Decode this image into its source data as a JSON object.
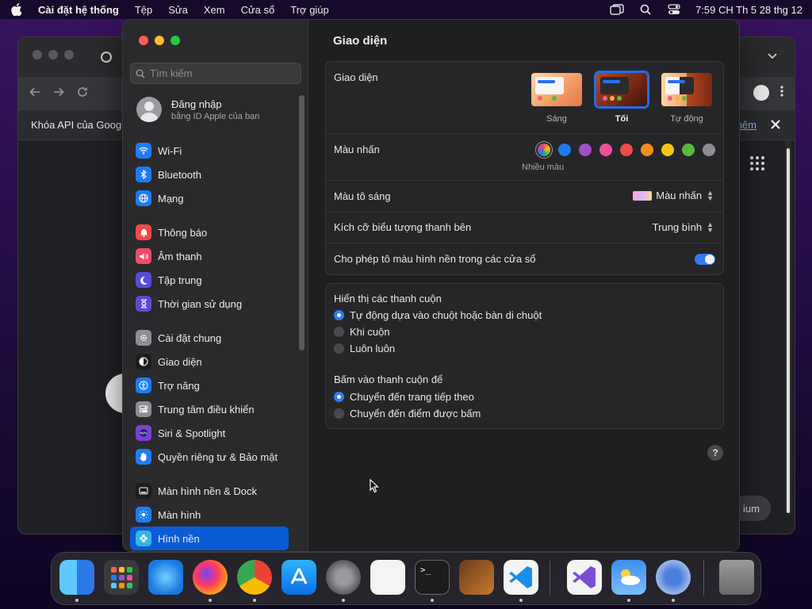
{
  "menubar": {
    "app_name": "Cài đặt hệ thống",
    "items": [
      "Tệp",
      "Sửa",
      "Xem",
      "Cửa sổ",
      "Trợ giúp"
    ],
    "clock": "7:59 CH Th 5 28 thg 12"
  },
  "browser": {
    "infobar_text": "Khóa API của Goog",
    "infobar_link": "hêm",
    "pill_text": "ium"
  },
  "sidebar": {
    "search_placeholder": "Tìm kiếm",
    "account": {
      "title": "Đăng nhập",
      "subtitle": "bằng ID Apple của bạn"
    },
    "groups": [
      [
        {
          "label": "Wi-Fi",
          "icon": "wifi-icon",
          "color": "#1e7cf2"
        },
        {
          "label": "Bluetooth",
          "icon": "bluetooth-icon",
          "color": "#1e7cf2"
        },
        {
          "label": "Mạng",
          "icon": "globe-icon",
          "color": "#1e7cf2"
        }
      ],
      [
        {
          "label": "Thông báo",
          "icon": "bell-icon",
          "color": "#ef4b43"
        },
        {
          "label": "Âm thanh",
          "icon": "speaker-icon",
          "color": "#ef4b6b"
        },
        {
          "label": "Tập trung",
          "icon": "moon-icon",
          "color": "#5a4bd6"
        },
        {
          "label": "Thời gian sử dụng",
          "icon": "hourglass-icon",
          "color": "#5a4bd6"
        }
      ],
      [
        {
          "label": "Cài đặt chung",
          "icon": "gear-icon",
          "color": "#8e8e93"
        },
        {
          "label": "Giao diện",
          "icon": "appearance-icon",
          "color": "#1c1c1e"
        },
        {
          "label": "Trợ năng",
          "icon": "accessibility-icon",
          "color": "#1e7cf2"
        },
        {
          "label": "Trung tâm điều khiển",
          "icon": "control-center-icon",
          "color": "#8e8e93"
        },
        {
          "label": "Siri & Spotlight",
          "icon": "siri-icon",
          "color": "#7a3fd8"
        },
        {
          "label": "Quyền riêng tư & Bảo mật",
          "icon": "hand-icon",
          "color": "#1e7cf2"
        }
      ],
      [
        {
          "label": "Màn hình nền & Dock",
          "icon": "dock-icon",
          "color": "#1c1c1e"
        },
        {
          "label": "Màn hình",
          "icon": "sun-icon",
          "color": "#1e7cf2"
        },
        {
          "label": "Hình nền",
          "icon": "wallpaper-icon",
          "color": "#35b5e8",
          "active": true
        }
      ]
    ]
  },
  "main": {
    "title": "Giao diện",
    "appearance": {
      "label": "Giao diện",
      "options": [
        {
          "caption": "Sáng",
          "selected": false
        },
        {
          "caption": "Tối",
          "selected": true
        },
        {
          "caption": "Tự động",
          "selected": false
        }
      ]
    },
    "accent": {
      "label": "Màu nhấn",
      "caption": "Nhiều màu",
      "colors": [
        "multicolor",
        "#1e7cf2",
        "#a050c8",
        "#f0509a",
        "#f04a4a",
        "#f58c1e",
        "#f5c518",
        "#5ab840",
        "#8e8e93"
      ],
      "selected_index": 0
    },
    "highlight": {
      "label": "Màu tô sáng",
      "value": "Màu nhấn"
    },
    "sidebar_icon_size": {
      "label": "Kích cỡ biểu tượng thanh bên",
      "value": "Trung bình"
    },
    "wallpaper_tint": {
      "label": "Cho phép tô màu hình nền trong các cửa sổ",
      "on": true
    },
    "scrollbars": {
      "heading": "Hiển thị các thanh cuộn",
      "options": [
        "Tự động dựa vào chuột hoặc bàn di chuột",
        "Khi cuộn",
        "Luôn luôn"
      ],
      "selected_index": 0
    },
    "click_scrollbar": {
      "heading": "Bấm vào thanh cuộn để",
      "options": [
        "Chuyển đến trang tiếp theo",
        "Chuyển đến điểm được bấm"
      ],
      "selected_index": 0
    },
    "help": "?"
  },
  "dock": {
    "apps": [
      "finder-icon",
      "launchpad-icon",
      "safari-icon",
      "firefox-icon",
      "chrome-icon",
      "app-store-icon",
      "system-settings-icon",
      "textedit-icon",
      "terminal-icon",
      "garageband-icon",
      "vscode-icon",
      "visual-studio-icon",
      "weather-icon",
      "chromium-icon",
      "trash-icon"
    ],
    "running": [
      "finder-icon",
      "firefox-icon",
      "chrome-icon",
      "system-settings-icon",
      "terminal-icon",
      "vscode-icon",
      "weather-icon",
      "chromium-icon"
    ]
  }
}
